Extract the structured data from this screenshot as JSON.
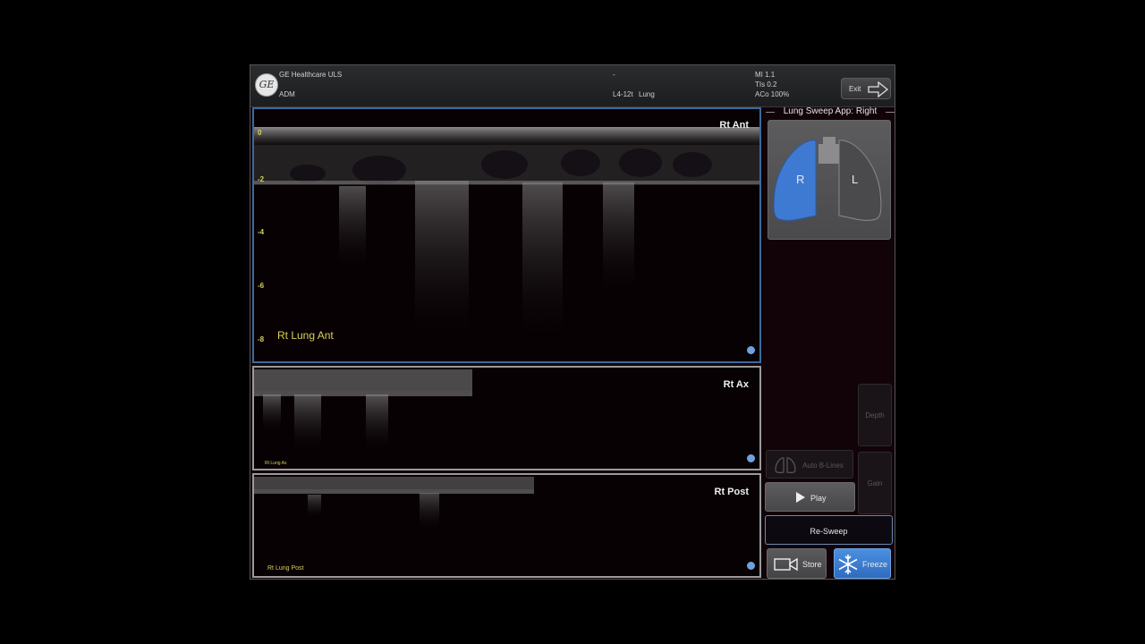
{
  "header": {
    "logo_text": "GE",
    "brand": "GE Healthcare ULS",
    "user": "ADM",
    "center_top": "-",
    "probe": "L4-12t",
    "preset": "Lung",
    "mi": "MI 1.1",
    "tis": "TIs 0.2",
    "aco": "ACo 100%",
    "exit_label": "Exit"
  },
  "panes": [
    {
      "title": "Rt Ant",
      "label": "Rt Lung Ant",
      "depth_ticks": [
        "0",
        "-2",
        "-4",
        "-6",
        "-8"
      ]
    },
    {
      "title": "Rt Ax",
      "label": "Rt Lung Ax"
    },
    {
      "title": "Rt Post",
      "label": "Rt Lung Post"
    }
  ],
  "sidebar": {
    "app_title": "Lung Sweep App: Right",
    "lung_right": "R",
    "lung_left": "L",
    "depth_label": "Depth",
    "gain_label": "Gain",
    "auto_blines_label": "Auto B-Lines",
    "play_label": "Play",
    "resweep_label": "Re-Sweep",
    "store_label": "Store",
    "freeze_label": "Freeze"
  },
  "colors": {
    "active_border": "#3a6a9c",
    "selected_lung": "#3f7ad2",
    "freeze_accent": "#3b7bd6",
    "annotation_yellow": "#d8d05a"
  },
  "icons": [
    "ge-logo",
    "exit-arrow-icon",
    "lungs-icon",
    "play-icon",
    "camera-icon",
    "snowflake-icon"
  ]
}
